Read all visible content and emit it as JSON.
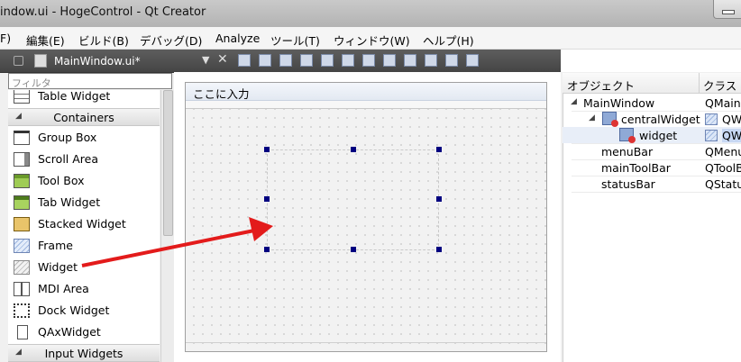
{
  "window": {
    "title": "indow.ui - HogeControl - Qt Creator"
  },
  "menubar": {
    "items": [
      "F)",
      "編集(E)",
      "ビルド(B)",
      "デバッグ(D)",
      "Analyze",
      "ツール(T)",
      "ウィンドウ(W)",
      "ヘルプ(H)"
    ]
  },
  "editor_toolbar": {
    "file_name": "MainWindow.ui*",
    "dropdown": "▼",
    "close": "✕"
  },
  "widget_box": {
    "filter_placeholder": "フィルタ",
    "items": [
      {
        "label": "Table Widget",
        "icon": "table-widget-icon"
      },
      {
        "label": "Containers",
        "category": true
      },
      {
        "label": "Group Box",
        "icon": "group-box-icon"
      },
      {
        "label": "Scroll Area",
        "icon": "scroll-area-icon"
      },
      {
        "label": "Tool Box",
        "icon": "tool-box-icon"
      },
      {
        "label": "Tab Widget",
        "icon": "tab-widget-icon"
      },
      {
        "label": "Stacked Widget",
        "icon": "stacked-widget-icon"
      },
      {
        "label": "Frame",
        "icon": "frame-icon"
      },
      {
        "label": "Widget",
        "icon": "widget-icon"
      },
      {
        "label": "MDI Area",
        "icon": "mdi-area-icon"
      },
      {
        "label": "Dock Widget",
        "icon": "dock-widget-icon"
      },
      {
        "label": "QAxWidget",
        "icon": "qaxwidget-icon"
      },
      {
        "label": "Input Widgets",
        "category": true
      }
    ]
  },
  "form": {
    "menu_placeholder": "ここに入力"
  },
  "object_inspector": {
    "header_object": "オブジェクト",
    "header_class": "クラス",
    "rows": [
      {
        "name": "MainWindow",
        "class": "QMainWindow"
      },
      {
        "name": "centralWidget",
        "class": "QWidget"
      },
      {
        "name": "widget",
        "class": "QWidget"
      },
      {
        "name": "menuBar",
        "class": "QMenuBar"
      },
      {
        "name": "mainToolBar",
        "class": "QToolBar"
      },
      {
        "name": "statusBar",
        "class": "QStatusBar"
      }
    ]
  },
  "annotation": {
    "arrow_color": "#e31b1b"
  }
}
